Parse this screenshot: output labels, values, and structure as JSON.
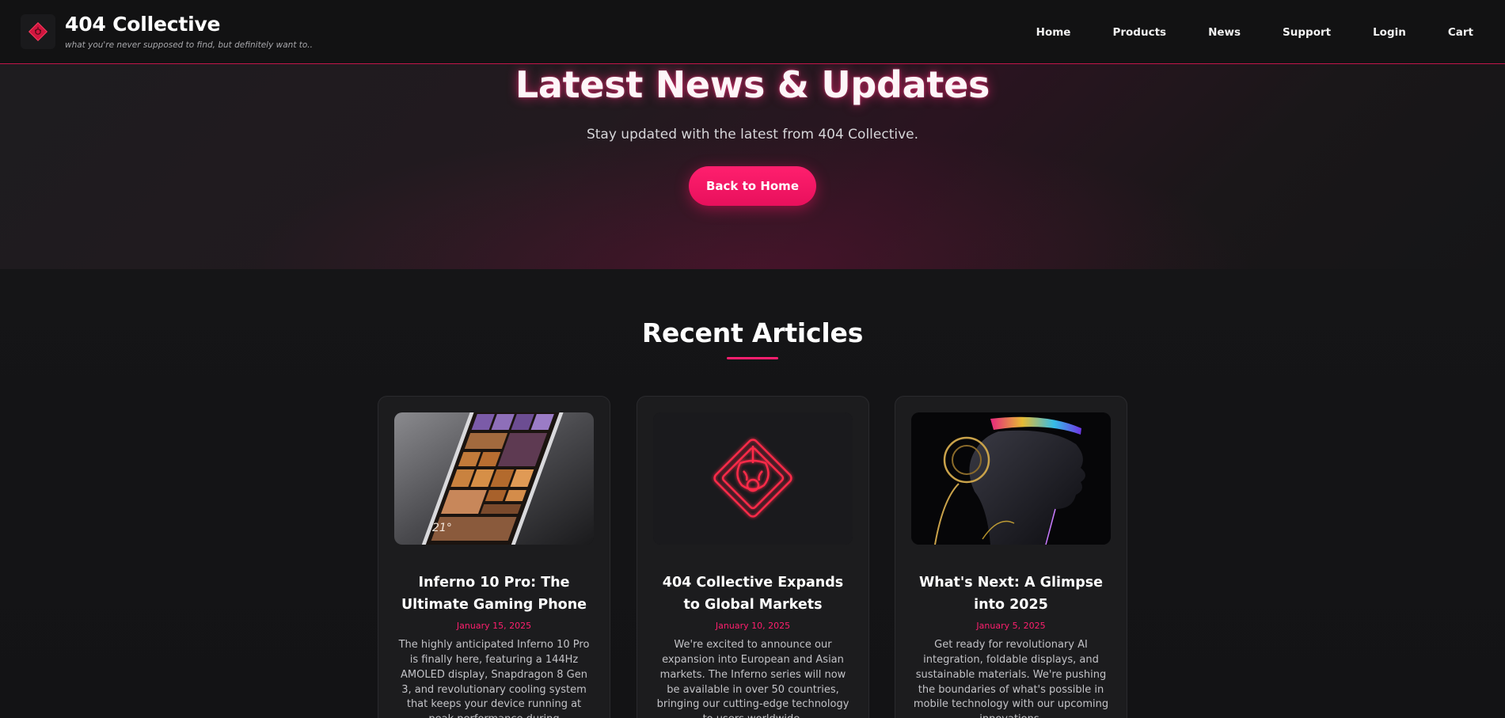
{
  "header": {
    "brand_title": "404 Collective",
    "brand_tagline": "what you're never supposed to find, but definitely want to..",
    "logo_icon": "404-diamond-logo-icon"
  },
  "nav": {
    "items": [
      {
        "label": "Home"
      },
      {
        "label": "Products"
      },
      {
        "label": "News"
      },
      {
        "label": "Support"
      },
      {
        "label": "Login"
      },
      {
        "label": "Cart"
      }
    ]
  },
  "hero": {
    "title": "Latest News & Updates",
    "subtitle": "Stay updated with the latest from 404 Collective.",
    "button_label": "Back to Home"
  },
  "articles": {
    "section_title": "Recent Articles",
    "items": [
      {
        "title": "Inferno 10 Pro: The Ultimate Gaming Phone",
        "date": "January 15, 2025",
        "excerpt": "The highly anticipated Inferno 10 Pro is finally here, featuring a 144Hz AMOLED display, Snapdragon 8 Gen 3, and revolutionary cooling system that keeps your device running at peak performance during",
        "image": "phone-tiles-image"
      },
      {
        "title": "404 Collective Expands to Global Markets",
        "date": "January 10, 2025",
        "excerpt": "We're excited to announce our expansion into European and Asian markets. The Inferno series will now be available in over 50 countries, bringing our cutting-edge technology to users worldwide.",
        "image": "neon-diamond-logo-image"
      },
      {
        "title": "What's Next: A Glimpse into 2025",
        "date": "January 5, 2025",
        "excerpt": "Get ready for revolutionary AI integration, foldable displays, and sustainable materials. We're pushing the boundaries of what's possible in mobile technology with our upcoming innovations.",
        "image": "cyborg-profile-image"
      }
    ]
  },
  "colors": {
    "accent": "#ff1f6e",
    "background": "#141416",
    "card": "#1c1c1e"
  }
}
